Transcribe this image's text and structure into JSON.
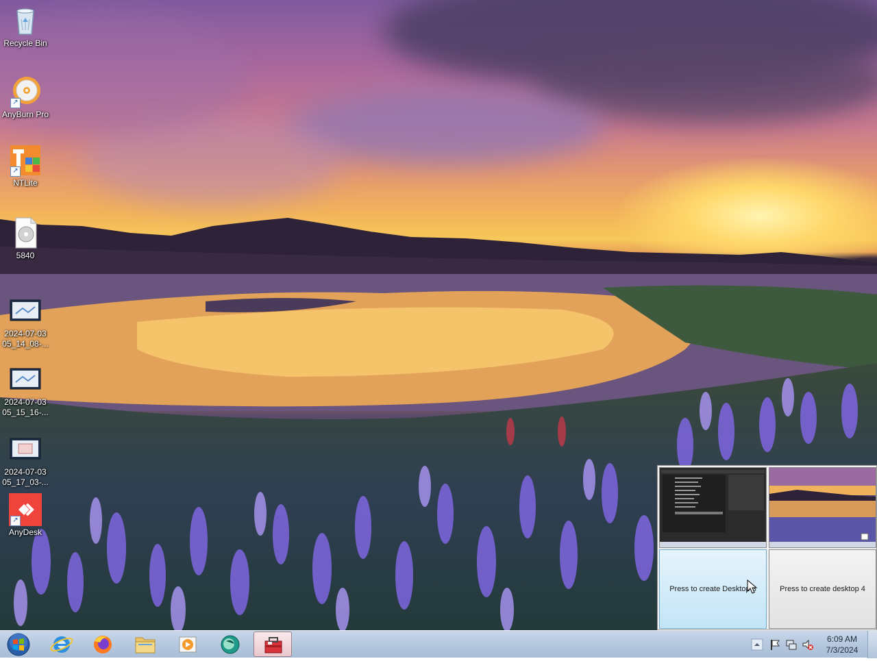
{
  "desktop": {
    "icons": [
      {
        "name": "recycle-bin",
        "label": "Recycle Bin"
      },
      {
        "name": "anyburn-pro",
        "label": "AnyBurn Pro"
      },
      {
        "name": "ntlite",
        "label": "NTLite"
      },
      {
        "name": "file-5840",
        "label": "5840"
      },
      {
        "name": "screenshot-1",
        "label": "2024-07-03 05_14_08-..."
      },
      {
        "name": "screenshot-2",
        "label": "2024-07-03 05_15_16-..."
      },
      {
        "name": "screenshot-3",
        "label": "2024-07-03 05_17_03-..."
      },
      {
        "name": "anydesk",
        "label": "AnyDesk"
      }
    ]
  },
  "virtual_desktops": {
    "create_desktop_3": "Press to create Desktop 3",
    "create_desktop_4": "Press to create desktop 4"
  },
  "taskbar": {
    "pinned": [
      "start-orb",
      "internet-explorer",
      "firefox",
      "file-explorer",
      "media-player",
      "app-globe",
      "toolbox-app"
    ],
    "active_item": "toolbox-app"
  },
  "tray": {
    "time": "6:09 AM",
    "date": "7/3/2024"
  },
  "colors": {
    "taskbar": "#b5c8df",
    "anydesk": "#ef443b",
    "hover_tile": "#c2e4f6"
  }
}
